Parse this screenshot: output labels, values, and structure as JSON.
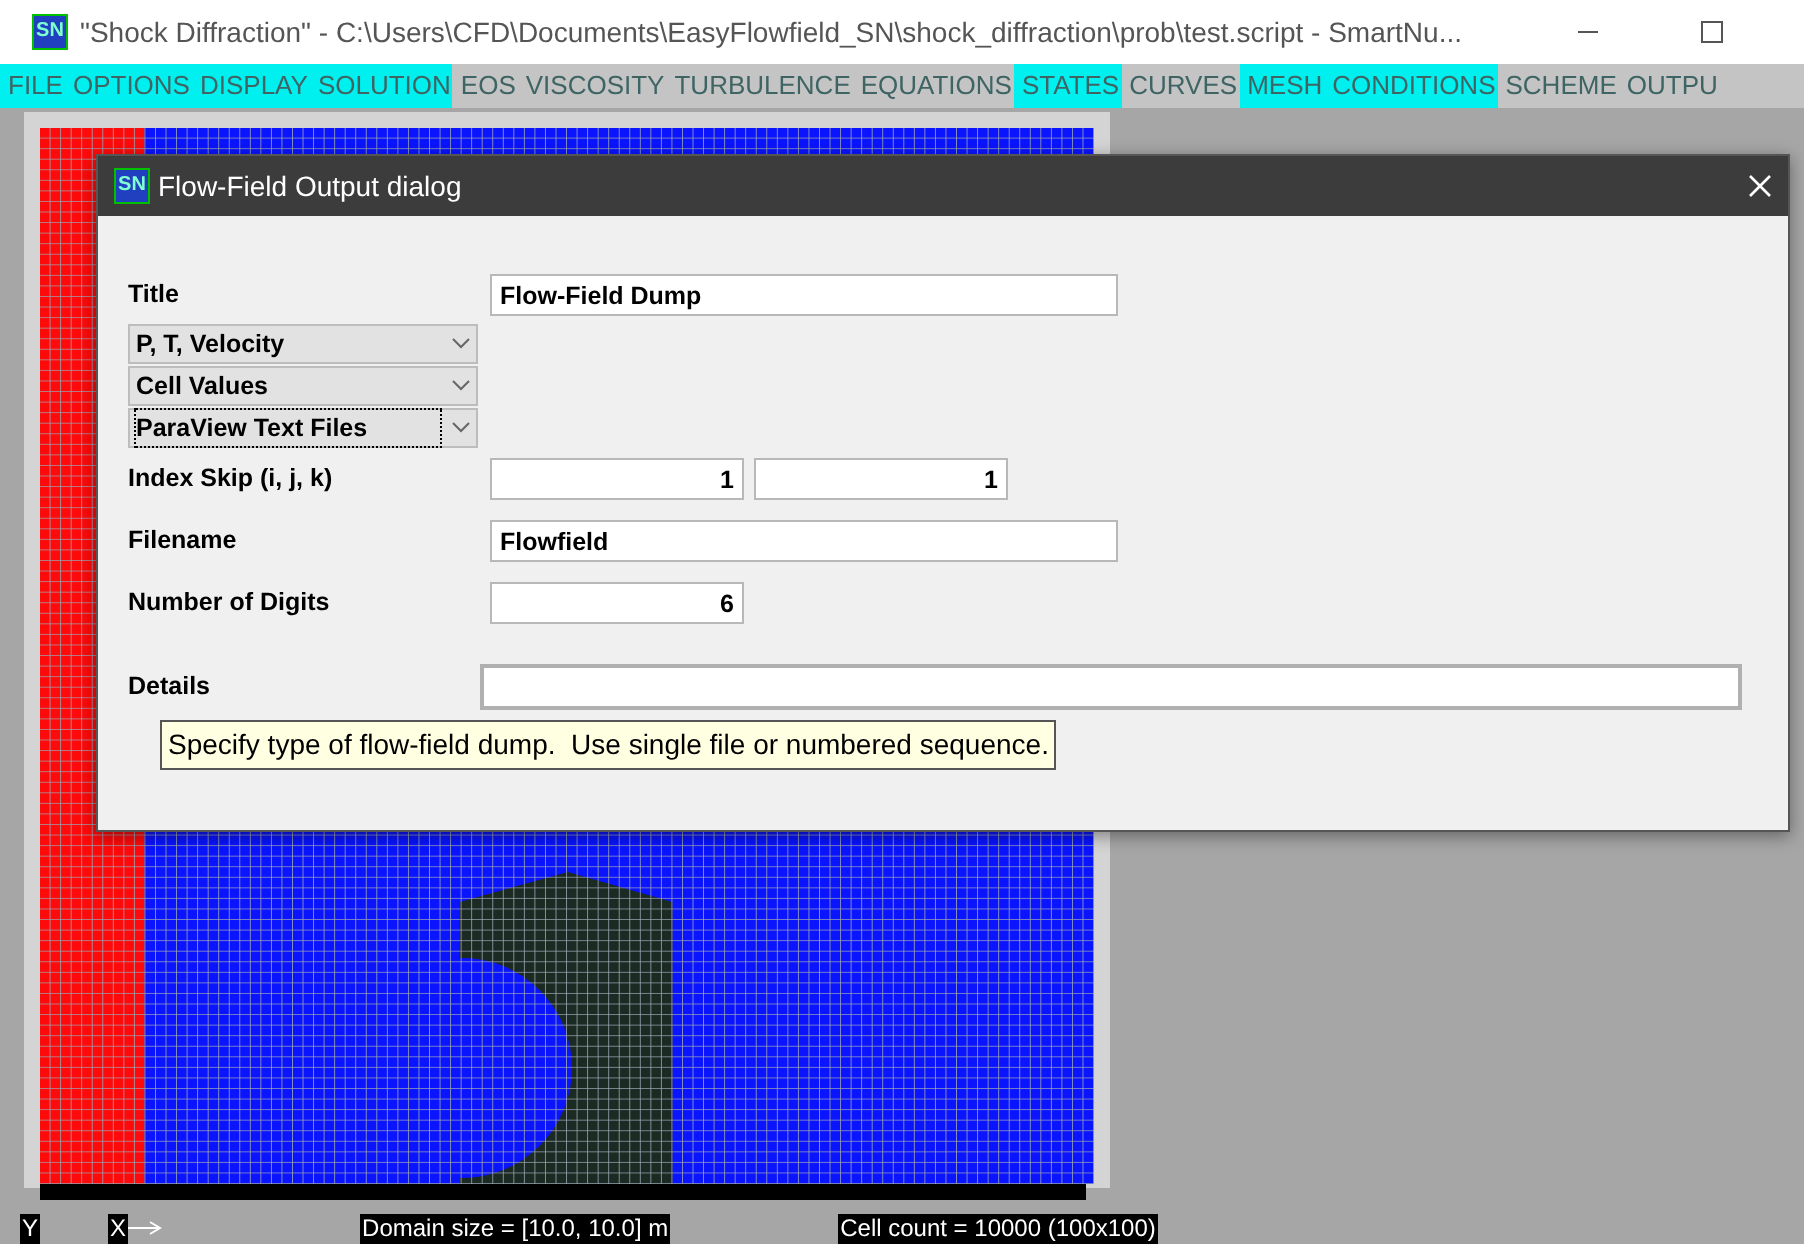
{
  "window": {
    "title": "\"Shock Diffraction\" - C:\\Users\\CFD\\Documents\\EasyFlowfield_SN\\shock_diffraction\\prob\\test.script - SmartNu...",
    "icon": "SN"
  },
  "menu": [
    {
      "label": "FILE",
      "highlighted": true
    },
    {
      "label": "OPTIONS",
      "highlighted": true
    },
    {
      "label": "DISPLAY",
      "highlighted": true
    },
    {
      "label": "SOLUTION",
      "highlighted": true
    },
    {
      "label": "EOS",
      "highlighted": false
    },
    {
      "label": "VISCOSITY",
      "highlighted": false
    },
    {
      "label": "TURBULENCE",
      "highlighted": false
    },
    {
      "label": "EQUATIONS",
      "highlighted": false
    },
    {
      "label": "STATES",
      "highlighted": true
    },
    {
      "label": "CURVES",
      "highlighted": false
    },
    {
      "label": "MESH",
      "highlighted": true
    },
    {
      "label": "CONDITIONS",
      "highlighted": true
    },
    {
      "label": "SCHEME",
      "highlighted": false
    },
    {
      "label": "OUTPU",
      "highlighted": false
    }
  ],
  "dialog": {
    "title": "Flow-Field Output dialog",
    "icon": "SN",
    "title_label": "Title",
    "title_value": "Flow-Field Dump",
    "dropdowns": [
      {
        "value": "P, T, Velocity",
        "focused": false
      },
      {
        "value": "Cell Values",
        "focused": false
      },
      {
        "value": "ParaView Text Files",
        "focused": true
      }
    ],
    "index_skip": {
      "label": "Index Skip (i, j, k)",
      "values": [
        "1",
        "1"
      ]
    },
    "filename": {
      "label": "Filename",
      "value": "Flowfield"
    },
    "digits": {
      "label": "Number of Digits",
      "value": "6"
    },
    "details": {
      "label": "Details"
    },
    "tooltip": "Specify type of flow-field dump.  Use single file or numbered sequence."
  },
  "status": {
    "y_axis": "Y",
    "x_axis": "X",
    "domain": "Domain size = [10.0, 10.0] m",
    "cells": "Cell count = 10000 (100x100)"
  }
}
